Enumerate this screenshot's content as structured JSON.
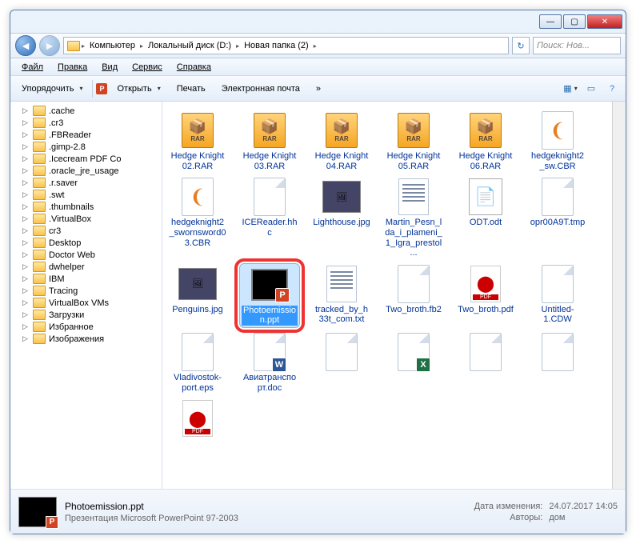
{
  "titlebar": {
    "min": "—",
    "max": "▢",
    "close": "✕"
  },
  "nav": {
    "back": "◄",
    "fwd": "►",
    "crumbs": [
      "Компьютер",
      "Локальный диск (D:)",
      "Новая папка (2)"
    ],
    "refresh": "↻",
    "search_placeholder": "Поиск: Нов..."
  },
  "menu": [
    "Файл",
    "Правка",
    "Вид",
    "Сервис",
    "Справка"
  ],
  "toolbar": {
    "organize": "Упорядочить",
    "open": "Открыть",
    "print": "Печать",
    "email": "Электронная почта",
    "more": "»"
  },
  "tree": [
    ".cache",
    ".cr3",
    ".FBReader",
    ".gimp-2.8",
    ".Icecream PDF Co",
    ".oracle_jre_usage",
    ".r.saver",
    ".swt",
    ".thumbnails",
    ".VirtualBox",
    "cr3",
    "Desktop",
    "Doctor Web",
    "dwhelper",
    "IBM",
    "Tracing",
    "VirtualBox VMs",
    "Загрузки",
    "Избранное",
    "Изображения"
  ],
  "files": [
    {
      "name": "Hedge Knight 02.RAR",
      "t": "rar"
    },
    {
      "name": "Hedge Knight 03.RAR",
      "t": "rar"
    },
    {
      "name": "Hedge Knight 04.RAR",
      "t": "rar"
    },
    {
      "name": "Hedge Knight 05.RAR",
      "t": "rar"
    },
    {
      "name": "Hedge Knight 06.RAR",
      "t": "rar"
    },
    {
      "name": "hedgeknight2_sw.CBR",
      "t": "cbr"
    },
    {
      "name": "hedgeknight2_swornsword03.CBR",
      "t": "cbr"
    },
    {
      "name": "ICEReader.hhc",
      "t": "doc"
    },
    {
      "name": "Lighthouse.jpg",
      "t": "img"
    },
    {
      "name": "Martin_Pesn_lda_i_plameni_1_Igra_prestol...",
      "t": "txt"
    },
    {
      "name": "ODT.odt",
      "t": "odt"
    },
    {
      "name": "opr00A9T.tmp",
      "t": "doc"
    },
    {
      "name": "Penguins.jpg",
      "t": "img"
    },
    {
      "name": "Photoemission.ppt",
      "t": "ppt",
      "sel": true,
      "hl": true
    },
    {
      "name": "tracked_by_h33t_com.txt",
      "t": "txt"
    },
    {
      "name": "Two_broth.fb2",
      "t": "doc"
    },
    {
      "name": "Two_broth.pdf",
      "t": "pdf"
    },
    {
      "name": "Untitled-1.CDW",
      "t": "doc"
    },
    {
      "name": "Vladivostok-port.eps",
      "t": "doc"
    },
    {
      "name": "Авиатранспорт.doc",
      "t": "word"
    },
    {
      "name": "",
      "t": "doc"
    },
    {
      "name": "",
      "t": "excel"
    },
    {
      "name": "",
      "t": "doc"
    },
    {
      "name": "",
      "t": "doc"
    },
    {
      "name": "",
      "t": "pdf"
    }
  ],
  "details": {
    "filename": "Photoemission.ppt",
    "filetype": "Презентация Microsoft PowerPoint 97-2003",
    "modified_k": "Дата изменения:",
    "modified_v": "24.07.2017 14:05",
    "authors_k": "Авторы:",
    "authors_v": "дом"
  }
}
